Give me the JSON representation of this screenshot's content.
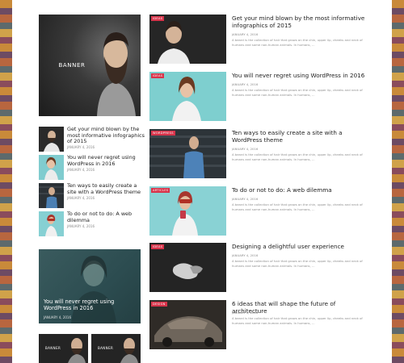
{
  "sidebar": {
    "banner_label": "BANNER",
    "list": [
      {
        "title": "Get your mind blown by the most informative infographics of 2015",
        "date": "JANUARY 4, 2016"
      },
      {
        "title": "You will never regret using WordPress in 2016",
        "date": "JANUARY 4, 2016"
      },
      {
        "title": "Ten ways to easily create a site with a WordPress theme",
        "date": "JANUARY 4, 2016"
      },
      {
        "title": "To do or not to do: A web dilemma",
        "date": "JANUARY 4, 2016"
      }
    ],
    "feature": {
      "title": "You will never regret using WordPress in 2016",
      "date": "JANUARY 4, 2016"
    },
    "mini_banners": [
      "BANNER",
      "BANNER"
    ]
  },
  "posts": [
    {
      "tag": "IDEAS",
      "title": "Get your mind blown by the most informative infographics of 2015",
      "date": "JANUARY 4, 2016",
      "excerpt": "A beard is the collection of hair that grows on the chin, upper lip, cheeks and neck of humans and some non-human animals. In humans, ..."
    },
    {
      "tag": "IDEAS",
      "title": "You will never regret using WordPress in 2016",
      "date": "JANUARY 4, 2016",
      "excerpt": "A beard is the collection of hair that grows on the chin, upper lip, cheeks and neck of humans and some non-human animals. In humans, ..."
    },
    {
      "tag": "WORDPRESS",
      "title": "Ten ways to easily create a site with a WordPress theme",
      "date": "JANUARY 4, 2016",
      "excerpt": "A beard is the collection of hair that grows on the chin, upper lip, cheeks and neck of humans and some non-human animals. In humans, ..."
    },
    {
      "tag": "ARTICLES",
      "title": "To do or not to do: A web dilemma",
      "date": "JANUARY 4, 2016",
      "excerpt": "A beard is the collection of hair that grows on the chin, upper lip, cheeks and neck of humans and some non-human animals. In humans, ..."
    },
    {
      "tag": "IDEAS",
      "title": "Designing a delightful user experience",
      "date": "JANUARY 4, 2016",
      "excerpt": "A beard is the collection of hair that grows on the chin, upper lip, cheeks and neck of humans and some non-human animals. In humans, ..."
    },
    {
      "tag": "DESIGN",
      "title": "6 ideas that will shape the future of architecture",
      "date": "JANUARY 4, 2016",
      "excerpt": "A beard is the collection of hair that grows on the chin, upper lip, cheeks and neck of humans and some non-human animals. In humans, ..."
    }
  ],
  "colors": {
    "tag_bg": "#d8334a",
    "teal_photo": "#7ecfcf",
    "dark_photo": "#262626"
  }
}
